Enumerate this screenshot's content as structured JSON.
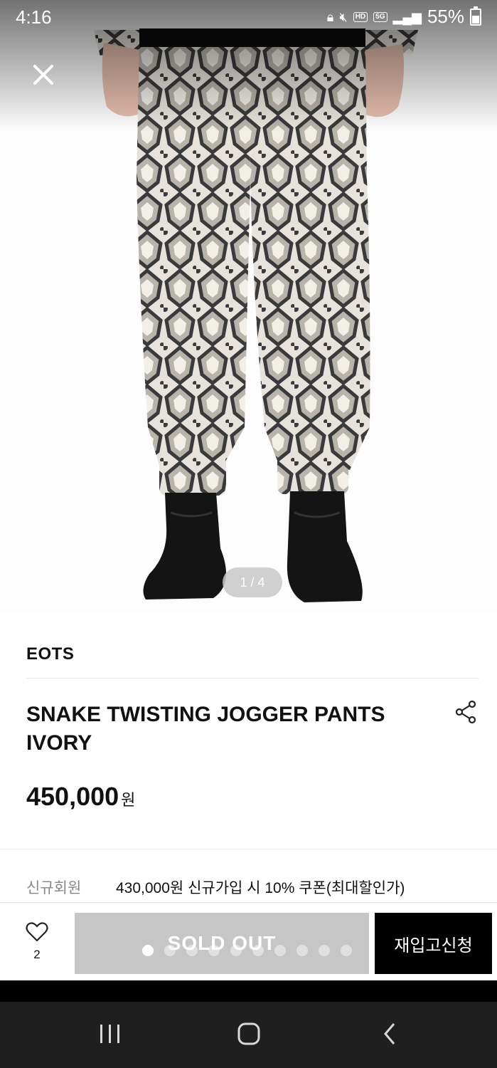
{
  "status_bar": {
    "time": "4:16",
    "battery": "55%",
    "icons": [
      "lock-icon",
      "mute-icon",
      "hd-voice-icon",
      "5g-icon",
      "signal-icon",
      "battery-icon"
    ],
    "hd_label": "HD",
    "net_label": "5G"
  },
  "gallery": {
    "pager": "1 / 4",
    "close_icon": "close-icon"
  },
  "product": {
    "brand": "EOTS",
    "title_line1": "SNAKE TWISTING JOGGER PANTS",
    "title_line2": "IVORY",
    "price": "450,000",
    "currency": "원",
    "share_icon": "share-icon"
  },
  "benefit": {
    "label": "신규회원",
    "text": "430,000원 신규가입 시 10% 쿠폰(최대할인가)"
  },
  "purchase_bar": {
    "wish_count": "2",
    "soldout_label": "SOLD OUT",
    "restock_label": "재입고신청",
    "dot_count": 10,
    "active_dot": 1
  },
  "colors": {
    "soldout_bg": "#c6c6c6",
    "restock_bg": "#000000",
    "nav_bg": "#1f1f1f"
  }
}
